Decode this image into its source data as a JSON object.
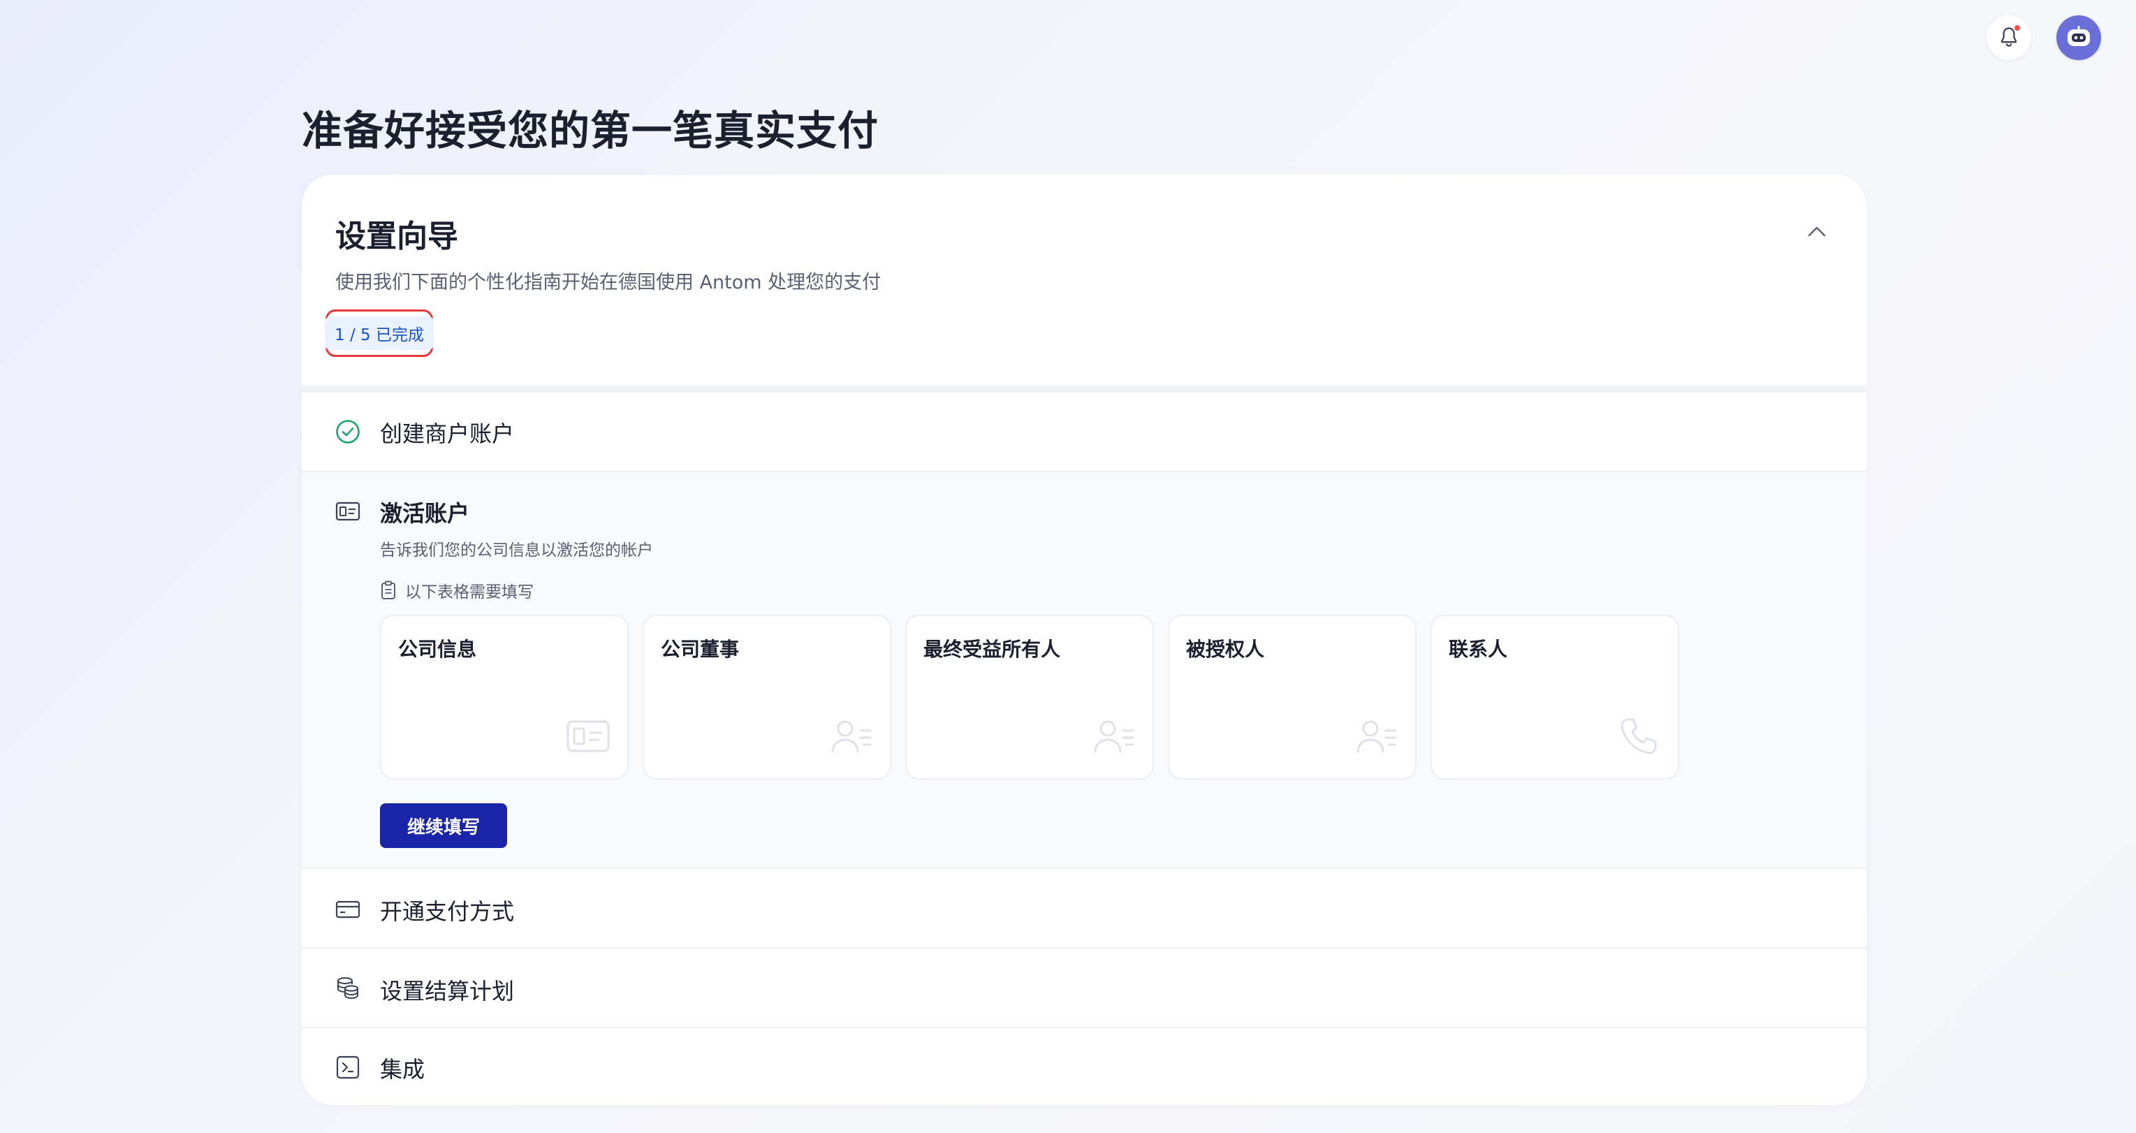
{
  "header": {
    "bell_icon": "bell-icon",
    "avatar_icon": "robot-avatar"
  },
  "page": {
    "title": "准备好接受您的第一笔真实支付"
  },
  "wizard": {
    "title": "设置向导",
    "description": "使用我们下面的个性化指南开始在德国使用 Antom 处理您的支付",
    "progress": "1 / 5 已完成",
    "collapse_icon": "chevron-up-icon",
    "steps": [
      {
        "title": "创建商户账户",
        "icon": "check-circle-icon",
        "status": "completed"
      },
      {
        "title": "激活账户",
        "icon": "id-card-icon",
        "status": "active",
        "description": "告诉我们您的公司信息以激活您的帐户",
        "forms_note": "以下表格需要填写",
        "forms": [
          {
            "label": "公司信息",
            "icon": "id-card-icon"
          },
          {
            "label": "公司董事",
            "icon": "user-list-icon"
          },
          {
            "label": "最终受益所有人",
            "icon": "user-list-icon"
          },
          {
            "label": "被授权人",
            "icon": "user-list-icon"
          },
          {
            "label": "联系人",
            "icon": "phone-icon"
          }
        ],
        "continue_label": "继续填写"
      },
      {
        "title": "开通支付方式",
        "icon": "credit-card-icon",
        "status": "pending"
      },
      {
        "title": "设置结算计划",
        "icon": "coins-icon",
        "status": "pending"
      },
      {
        "title": "集成",
        "icon": "terminal-icon",
        "status": "pending"
      }
    ]
  },
  "colors": {
    "primary_button": "#1a24a8",
    "success": "#1fa36b",
    "highlight_border": "#e53935",
    "badge_bg": "#eaf1ff",
    "badge_text": "#1a52c8"
  }
}
